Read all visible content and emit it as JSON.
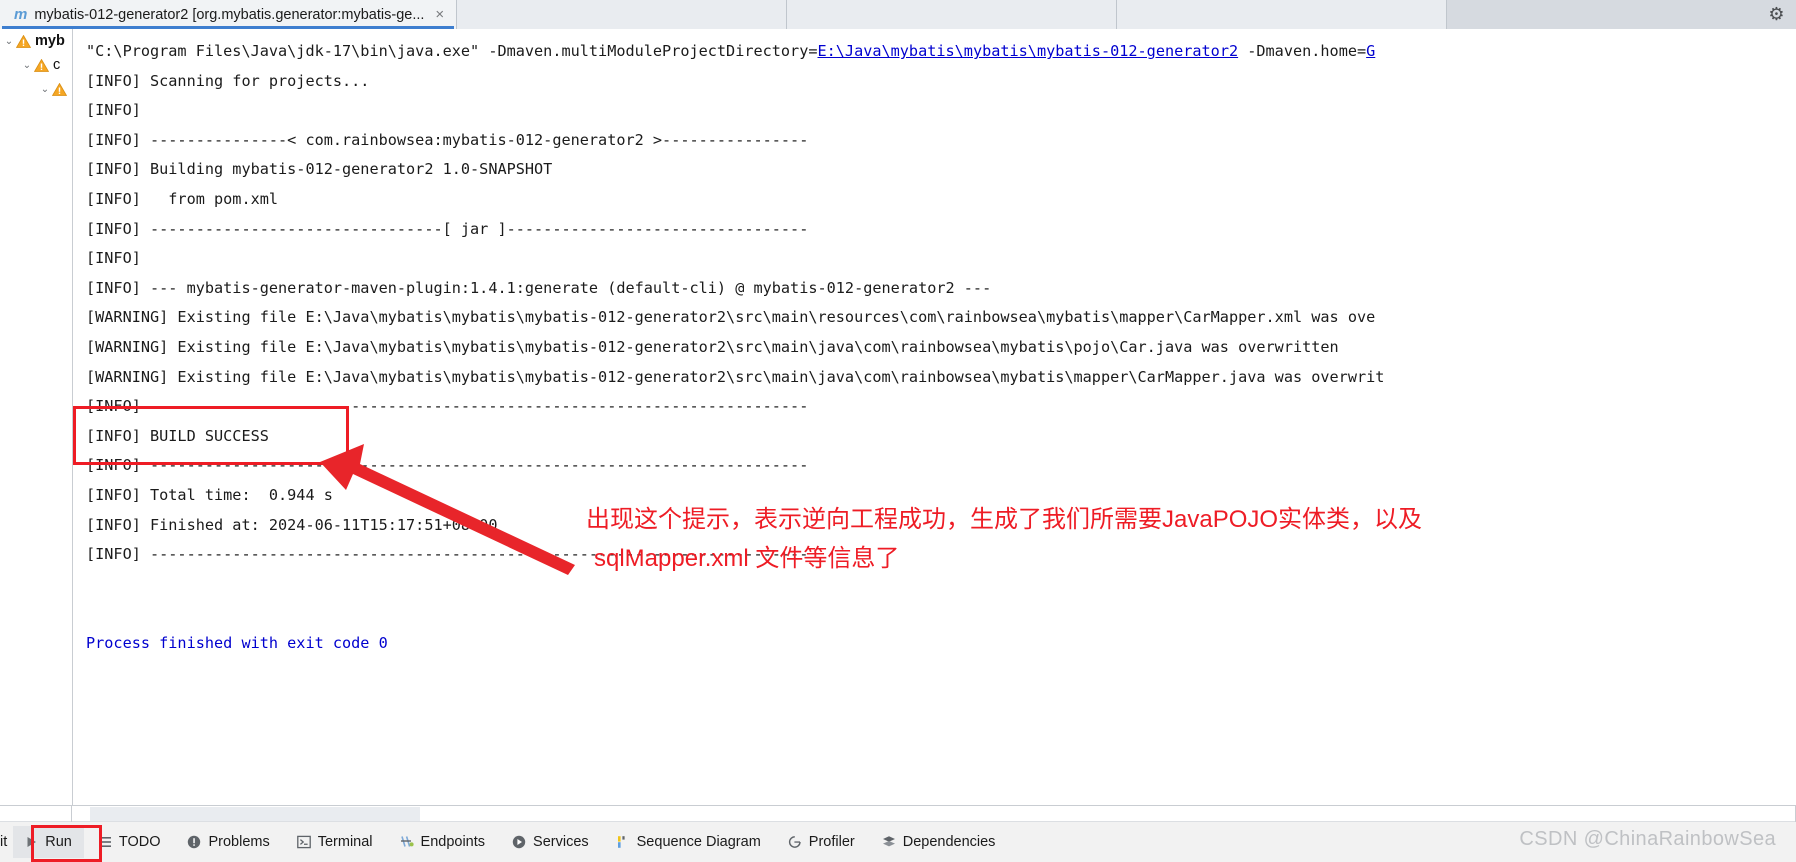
{
  "window": {
    "tab_title": "mybatis-012-generator2 [org.mybatis.generator:mybatis-ge...",
    "tab_icon": "maven-module-icon",
    "tab_close": "×",
    "settings_icon": "⚙"
  },
  "tree": {
    "items": [
      {
        "chevron": "⌄",
        "label": "myb",
        "icon": "warning-icon"
      },
      {
        "chevron": "⌄",
        "label": "c",
        "icon": "warning-icon"
      },
      {
        "chevron": "⌄",
        "label": "",
        "icon": "warning-icon"
      }
    ]
  },
  "console": {
    "lines": [
      {
        "type": "cmd",
        "pre": "\"C:\\Program Files\\Java\\jdk-17\\bin\\java.exe\" -Dmaven.multiModuleProjectDirectory=",
        "link": "E:\\Java\\mybatis\\mybatis\\mybatis-012-generator2",
        "post": " -Dmaven.home=",
        "tail_link": "G"
      },
      {
        "type": "text",
        "text": "[INFO] Scanning for projects..."
      },
      {
        "type": "text",
        "text": "[INFO]"
      },
      {
        "type": "text",
        "text": "[INFO] ---------------< com.rainbowsea:mybatis-012-generator2 >----------------"
      },
      {
        "type": "text",
        "text": "[INFO] Building mybatis-012-generator2 1.0-SNAPSHOT"
      },
      {
        "type": "text",
        "text": "[INFO]   from pom.xml"
      },
      {
        "type": "text",
        "text": "[INFO] --------------------------------[ jar ]---------------------------------"
      },
      {
        "type": "text",
        "text": "[INFO]"
      },
      {
        "type": "text",
        "text": "[INFO] --- mybatis-generator-maven-plugin:1.4.1:generate (default-cli) @ mybatis-012-generator2 ---"
      },
      {
        "type": "text",
        "text": "[WARNING] Existing file E:\\Java\\mybatis\\mybatis\\mybatis-012-generator2\\src\\main\\resources\\com\\rainbowsea\\mybatis\\mapper\\CarMapper.xml was ove"
      },
      {
        "type": "text",
        "text": "[WARNING] Existing file E:\\Java\\mybatis\\mybatis\\mybatis-012-generator2\\src\\main\\java\\com\\rainbowsea\\mybatis\\pojo\\Car.java was overwritten"
      },
      {
        "type": "text",
        "text": "[WARNING] Existing file E:\\Java\\mybatis\\mybatis\\mybatis-012-generator2\\src\\main\\java\\com\\rainbowsea\\mybatis\\mapper\\CarMapper.java was overwrit"
      },
      {
        "type": "text",
        "text": "[INFO] ------------------------------------------------------------------------"
      },
      {
        "type": "text",
        "text": "[INFO] BUILD SUCCESS"
      },
      {
        "type": "text",
        "text": "[INFO] ------------------------------------------------------------------------"
      },
      {
        "type": "text",
        "text": "[INFO] Total time:  0.944 s"
      },
      {
        "type": "text",
        "text": "[INFO] Finished at: 2024-06-11T15:17:51+08:00"
      },
      {
        "type": "text",
        "text": "[INFO] ------------------------------------------------------------------------"
      },
      {
        "type": "blank",
        "text": " "
      },
      {
        "type": "blank",
        "text": " "
      },
      {
        "type": "blue",
        "text": "Process finished with exit code 0"
      }
    ]
  },
  "annotation": {
    "line1": "出现这个提示，表示逆向工程成功，生成了我们所需要JavaPOJO实体类，以及",
    "line2": "sqlMapper.xml 文件等信息了",
    "color": "#ee1c25",
    "box_target": "[INFO] BUILD SUCCESS"
  },
  "statusbar": {
    "clipped_label": "it",
    "items": [
      {
        "label": "Run",
        "icon": "run-triangle-icon",
        "active": true
      },
      {
        "label": "TODO",
        "icon": "todo-list-icon",
        "active": false
      },
      {
        "label": "Problems",
        "icon": "problems-exclamation-icon",
        "active": false
      },
      {
        "label": "Terminal",
        "icon": "terminal-icon",
        "active": false
      },
      {
        "label": "Endpoints",
        "icon": "endpoints-icon",
        "active": false
      },
      {
        "label": "Services",
        "icon": "services-play-icon",
        "active": false
      },
      {
        "label": "Sequence Diagram",
        "icon": "sequence-diagram-icon",
        "active": false
      },
      {
        "label": "Profiler",
        "icon": "profiler-icon",
        "active": false
      },
      {
        "label": "Dependencies",
        "icon": "dependencies-icon",
        "active": false
      }
    ],
    "watermark": "CSDN @ChinaRainbowSea"
  }
}
